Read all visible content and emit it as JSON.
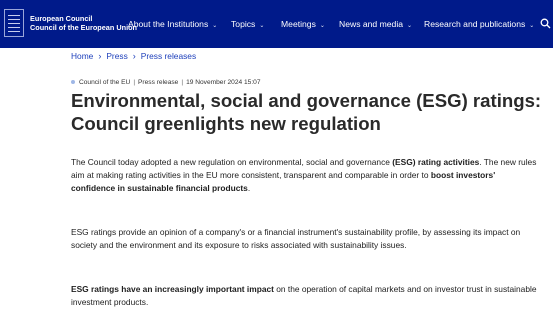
{
  "header": {
    "org_line1": "European Council",
    "org_line2": "Council of the European Union",
    "nav": [
      {
        "label": "About the Institutions"
      },
      {
        "label": "Topics"
      },
      {
        "label": "Meetings"
      },
      {
        "label": "News and media"
      },
      {
        "label": "Research and publications"
      }
    ],
    "icons": {
      "logo": "eu-flag-icon",
      "dropdown": "chevron-down-icon",
      "search": "search-icon"
    }
  },
  "breadcrumb": [
    "Home",
    "Press",
    "Press releases"
  ],
  "meta": {
    "source": "Council of the EU",
    "type": "Press release",
    "date": "19 November 2024 15:07"
  },
  "title": "Environmental, social and governance (ESG) ratings: Council greenlights new regulation",
  "paragraphs": {
    "p1": {
      "t1": "The Council today adopted a new regulation on environmental, social and governance ",
      "b1": "(ESG) rating activities",
      "t2": ". The new rules aim at making rating activities in the EU more consistent, transparent and comparable in order to ",
      "b2": "boost investors' confidence in sustainable financial products",
      "t3": "."
    },
    "p2": "ESG ratings provide an opinion of a company's or a financial instrument's sustainability profile, by assessing its impact on society and the environment and its exposure to risks associated with sustainability issues.",
    "p3": {
      "b1": "ESG ratings have an increasingly important impact",
      "t1": " on the operation of capital markets and on investor trust in sustainable investment products."
    }
  },
  "colors": {
    "header_bg": "#001a8a",
    "link": "#1d3fbb"
  }
}
